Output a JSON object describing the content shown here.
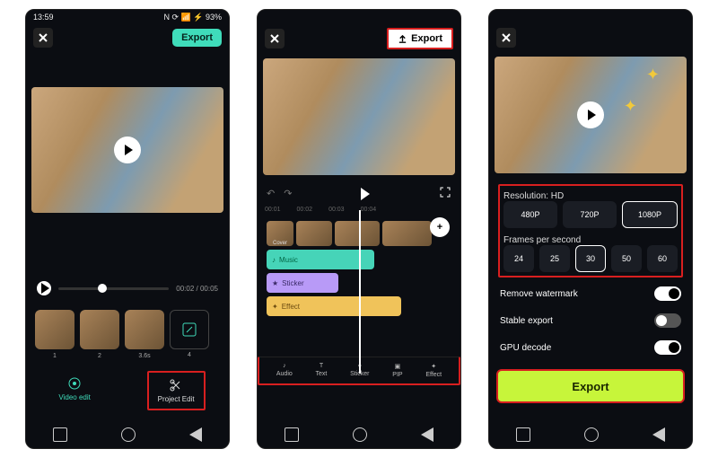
{
  "screen1": {
    "status": {
      "time": "13:59",
      "right": "N ⟳ 📶 ⚡ 93%"
    },
    "export_label": "Export",
    "progress": {
      "current": "00:02",
      "total": "00:05"
    },
    "clips": [
      "1",
      "2",
      "3.6s",
      "4"
    ],
    "bottom": {
      "video_edit": "Video edit",
      "project_edit": "Project Edit"
    }
  },
  "screen2": {
    "export_label": "Export",
    "ruler": [
      "00:01",
      "00:02",
      "00:03",
      "00:04"
    ],
    "cover": "Cover",
    "tracks": {
      "music": "Music",
      "sticker": "Sticker",
      "effect": "Effect"
    },
    "tools": [
      "Audio",
      "Text",
      "Sticker",
      "PIP",
      "Effect"
    ]
  },
  "screen3": {
    "resolution_title": "Resolution: HD",
    "resolutions": [
      "480P",
      "720P",
      "1080P"
    ],
    "fps_title": "Frames per second",
    "fps": [
      "24",
      "25",
      "30",
      "50",
      "60"
    ],
    "toggles": {
      "watermark": "Remove watermark",
      "stable": "Stable export",
      "gpu": "GPU decode"
    },
    "export_label": "Export"
  }
}
